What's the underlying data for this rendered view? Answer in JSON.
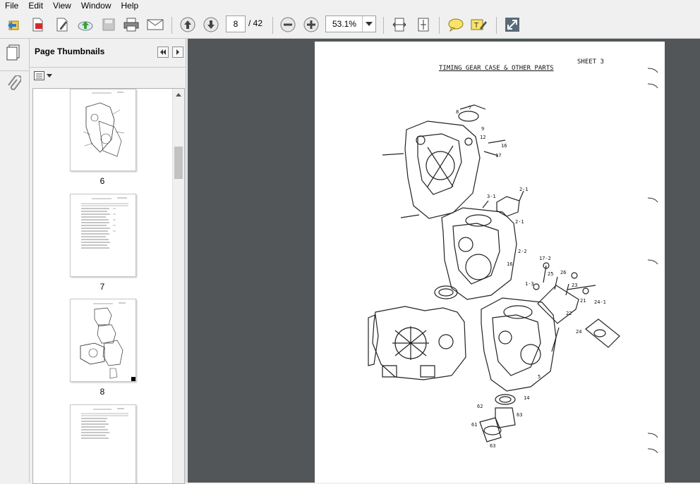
{
  "menu": [
    "File",
    "Edit",
    "View",
    "Window",
    "Help"
  ],
  "toolbar": {
    "page_current": "8",
    "page_total": "/ 42",
    "zoom": "53.1%"
  },
  "panel": {
    "title": "Page Thumbnails"
  },
  "thumbnails": [
    {
      "label": "6"
    },
    {
      "label": "7"
    },
    {
      "label": "8"
    }
  ],
  "document": {
    "title": "TIMING GEAR CASE & OTHER PARTS",
    "sheet": "SHEET   3"
  }
}
